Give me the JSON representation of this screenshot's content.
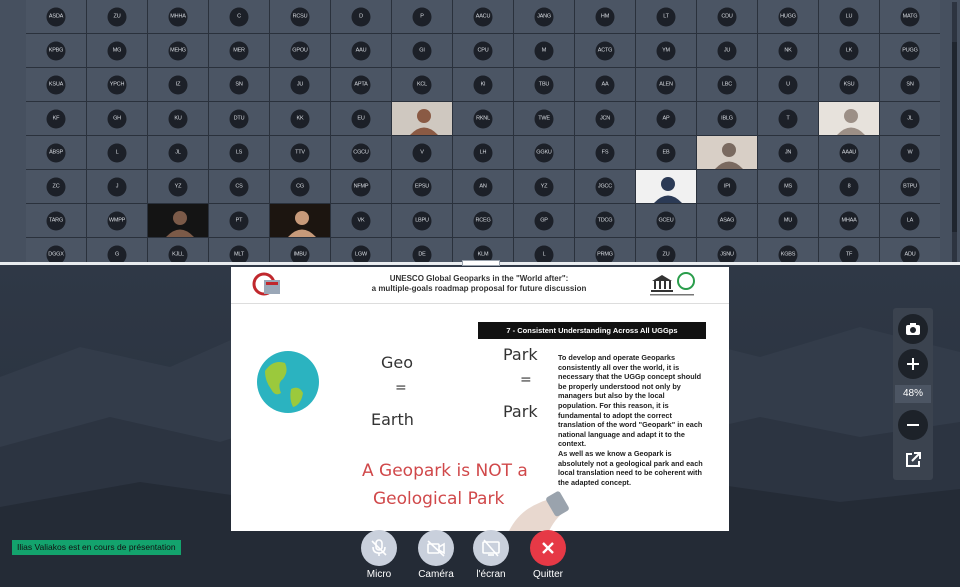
{
  "grid": {
    "rows": [
      [
        "ASDA",
        "ZU",
        "MHHA",
        "C",
        "RCSU",
        "D",
        "P",
        "AACU",
        "JANG",
        "HM",
        "LT",
        "CDU",
        "HUGG",
        "LU",
        "MATG"
      ],
      [
        "KPBG",
        "MG",
        "MEHG",
        "MER",
        "GPOU",
        "AAU",
        "GI",
        "CPU",
        "M",
        "ACTG",
        "YM",
        "JU",
        "NK",
        "LK",
        "PUGG"
      ],
      [
        "KSUA",
        "YPCH",
        "IZ",
        "SN",
        "JU",
        "APTA",
        "KCL",
        "KI",
        "TBU",
        "AA",
        "ALEN",
        "LBC",
        "U",
        "KSU",
        "SN"
      ],
      [
        "KF",
        "GH",
        "KU",
        "DTU",
        "KK",
        "EU",
        "",
        "RKNL",
        "TWE",
        "JCN",
        "AP",
        "IBLG",
        "T",
        "",
        "JL"
      ],
      [
        "ÁBSP",
        "L",
        "JL",
        "LS",
        "TTV",
        "CGCU",
        "V",
        "LH",
        "GGKU",
        "FS",
        "EB",
        "",
        "JN",
        "AAAU",
        "W"
      ],
      [
        "ZC",
        "J",
        "YZ",
        "CS",
        "CG",
        "NFMP",
        "EPSU",
        "AN",
        "YZ",
        "JGCC",
        "",
        "IPI",
        "MS",
        "8",
        "BTPU"
      ],
      [
        "TARG",
        "WMPP",
        "",
        "PT",
        "",
        "VK",
        "LBPU",
        "RCEG",
        "GP",
        "TDCG",
        "GCEU",
        "ASAG",
        "MU",
        "MHAA",
        "LA"
      ],
      [
        "DGGX",
        "G",
        "KJLL",
        "MLT",
        "IMBU",
        "LGW",
        "DE",
        "KLM",
        "L",
        "PRMG",
        "ZU",
        "JSNU",
        "KGBS",
        "TF",
        "ADU"
      ]
    ]
  },
  "slide": {
    "title_line1": "UNESCO Global Geoparks in the \"World after\":",
    "title_line2": "a multiple-goals roadmap proposal for future discussion",
    "section": "7 - Consistent Understanding Across All UGGps",
    "geo": "Geo",
    "eq": "=",
    "earth": "Earth",
    "park": "Park",
    "not_line1": "A Geopark is NOT a",
    "not_line2": "Geological Park",
    "body_p1": "To develop and operate Geoparks consistently all over the world, it is necessary that the UGGp concept should be properly understood not only by managers but also by the local population. For this reason, it is fundamental to adopt the correct translation of the word \"Geopark\" in each national language and adapt it to the context.",
    "body_p2": "As well as we know a Geopark is absolutely not a geological park and each local translation need to be coherent with the adapted concept."
  },
  "presenter_status": "Ilias Valiakos est en cours de présentation",
  "controls": {
    "micro": "Micro",
    "camera": "Caméra",
    "screen": "l'écran",
    "quit": "Quitter"
  },
  "zoom": {
    "level": "48%"
  },
  "colors": {
    "accent_green": "#13a36d",
    "quit_red": "#e63946",
    "handwriting_red": "#d0484a"
  }
}
